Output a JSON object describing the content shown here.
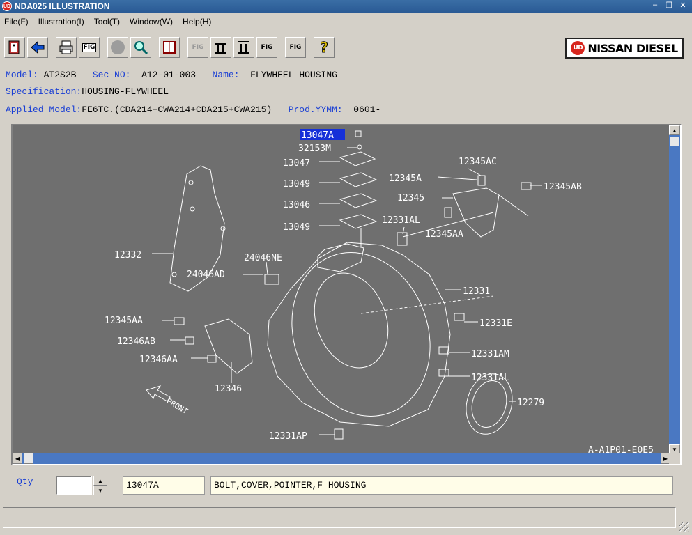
{
  "window": {
    "title": "NDA025 ILLUSTRATION",
    "app_icon_text": "UD",
    "controls": [
      "–",
      "❐",
      "✕"
    ]
  },
  "menu": [
    "File(F)",
    "Illustration(I)",
    "Tool(T)",
    "Window(W)",
    "Help(H)"
  ],
  "toolbar": {
    "buttons": [
      {
        "name": "exit-button",
        "icon": "exit-door-icon",
        "glyph": "🚪"
      },
      {
        "name": "back-button",
        "icon": "left-arrow-icon",
        "glyph": "⬅"
      },
      {
        "name": "print-button",
        "icon": "printer-icon",
        "glyph": "🖶"
      },
      {
        "name": "fig-button",
        "icon": "fig-icon",
        "glyph": "FIG"
      },
      {
        "name": "stop-button",
        "icon": "gray-circle-icon",
        "glyph": ""
      },
      {
        "name": "search-button",
        "icon": "magnifier-icon",
        "glyph": "🔍"
      },
      {
        "name": "book-button",
        "icon": "book-icon",
        "glyph": "📖"
      },
      {
        "name": "prev-fig-button",
        "icon": "prev-fig-icon",
        "glyph": "FIG"
      },
      {
        "name": "first-page-button",
        "icon": "first-page-icon",
        "glyph": "⫫"
      },
      {
        "name": "last-page-button",
        "icon": "last-page-icon",
        "glyph": "⫫"
      },
      {
        "name": "next-fig-button",
        "icon": "next-fig-icon",
        "glyph": "FIG"
      },
      {
        "name": "query-fig-button",
        "icon": "query-fig-icon",
        "glyph": "FIG"
      },
      {
        "name": "help-button",
        "icon": "question-icon",
        "glyph": "?"
      }
    ],
    "logo": {
      "mark": "UD",
      "text": "NISSAN DIESEL"
    }
  },
  "info": {
    "model_label": "Model:",
    "model_value": "AT2S2B",
    "secno_label": "Sec-NO:",
    "secno_value": "A12-01-003",
    "name_label": "Name:",
    "name_value": "FLYWHEEL HOUSING",
    "spec_label": "Specification:",
    "spec_value": "HOUSING-FLYWHEEL",
    "applied_label": "Applied Model:",
    "applied_value": "FE6TC.(CDA214+CWA214+CDA215+CWA215)",
    "prod_label": "Prod.YYMM:",
    "prod_value": "0601-"
  },
  "illustration": {
    "selected_part": "13047A",
    "labels": [
      "13047A",
      "32153M",
      "13047",
      "13049",
      "13046",
      "13049",
      "12345AC",
      "12345A",
      "12345AB",
      "12345",
      "12331AL",
      "12345AA",
      "12332",
      "24046NE",
      "24046AD",
      "12331",
      "12331E",
      "12345AA",
      "12346AB",
      "12346AA",
      "12331AM",
      "12331AL",
      "12346",
      "12279",
      "12331AP",
      "FRONT"
    ],
    "figure_code": "A-A1P01-E0E5"
  },
  "bottom": {
    "qty_label": "Qty",
    "qty_value": "",
    "part_number": "13047A",
    "part_description": "BOLT,COVER,POINTER,F HOUSING"
  }
}
